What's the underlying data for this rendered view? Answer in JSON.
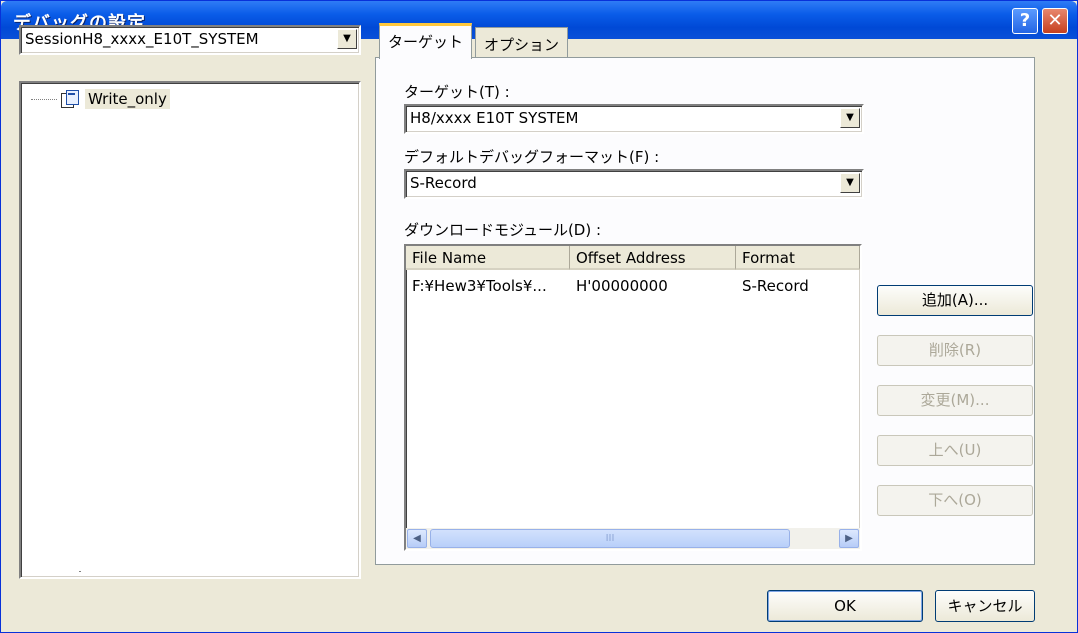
{
  "window": {
    "title": "デバッグの設定",
    "help_button": "?",
    "close_button": "✕"
  },
  "session": {
    "selected": "SessionH8_xxxx_E10T_SYSTEM"
  },
  "tree": {
    "items": [
      {
        "label": "Write_only"
      }
    ]
  },
  "tabs": [
    {
      "label": "ターゲット",
      "active": true
    },
    {
      "label": "オプション",
      "active": false
    }
  ],
  "target_tab": {
    "target_label": "ターゲット(T) :",
    "target_value": "H8/xxxx E10T SYSTEM",
    "format_label": "デフォルトデバッグフォーマット(F) :",
    "format_value": "S-Record",
    "modules_label": "ダウンロードモジュール(D) :",
    "columns": [
      "File Name",
      "Offset Address",
      "Format"
    ],
    "rows": [
      {
        "file_name": "F:¥Hew3¥Tools¥...",
        "offset": "H'00000000",
        "format": "S-Record"
      }
    ],
    "scroll_thumb_grip": "III"
  },
  "side_buttons": {
    "add": "追加(A)...",
    "delete": "削除(R)",
    "modify": "変更(M)...",
    "up": "上へ(U)",
    "down": "下へ(O)"
  },
  "footer": {
    "ok": "OK",
    "cancel": "キャンセル"
  },
  "icons": {
    "combo_arrow": "▼",
    "scroll_left": "◀",
    "scroll_right": "▶"
  }
}
